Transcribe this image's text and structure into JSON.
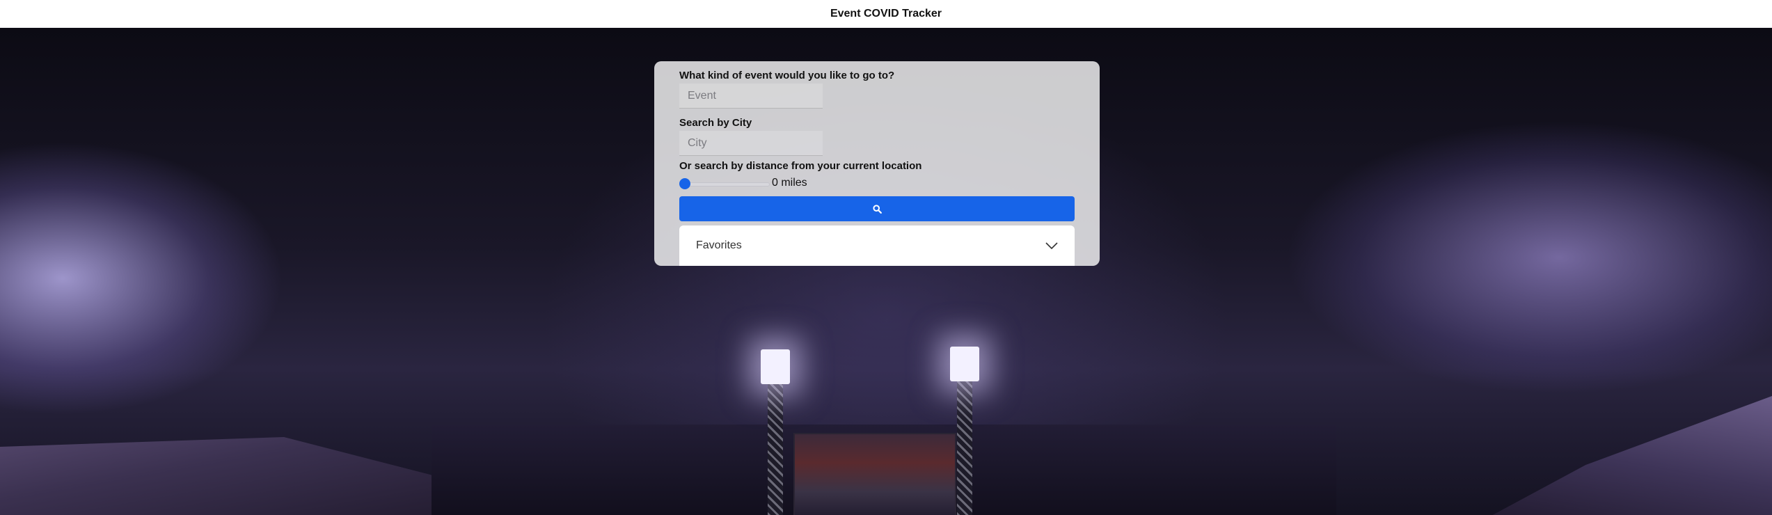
{
  "header": {
    "title": "Event COVID Tracker"
  },
  "form": {
    "event_label": "What kind of event would you like to go to?",
    "event_placeholder": "Event",
    "event_value": "",
    "city_label": "Search by City",
    "city_placeholder": "City",
    "city_value": "",
    "distance_label": "Or search by distance from your current location",
    "distance_value": 0,
    "distance_text": "0 miles",
    "search_icon": "search-icon",
    "favorites_label": "Favorites",
    "favorites_icon": "chevron-down-icon"
  },
  "background": {
    "scene": "baseball stadium at night"
  },
  "colors": {
    "accent": "#1764e8",
    "panel": "#ececee",
    "header_bg": "#ffffff"
  }
}
